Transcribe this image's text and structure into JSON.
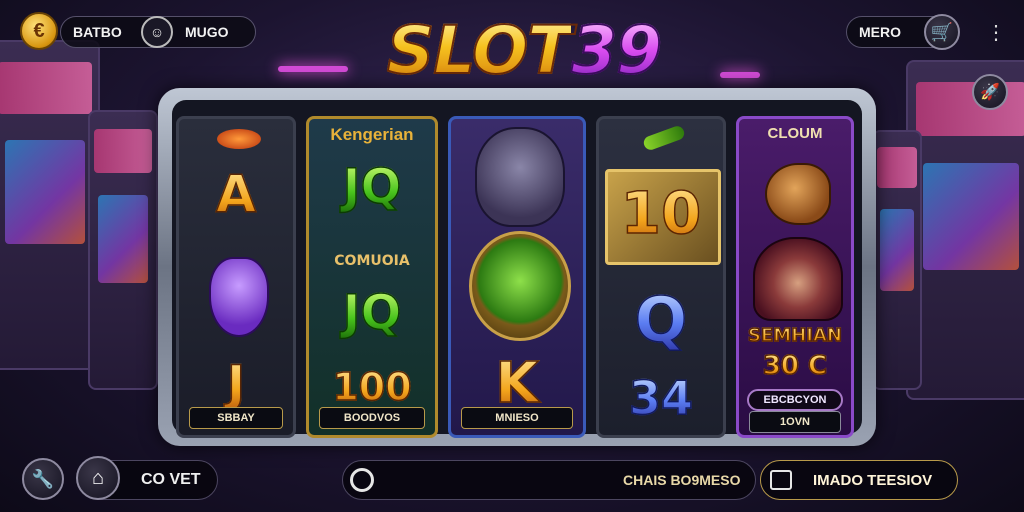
{
  "title": {
    "part1": "SLOT",
    "part2": "39"
  },
  "topbar": {
    "coin_symbol": "€",
    "left_label_1": "BATBO",
    "left_label_2": "MUGO",
    "right_label": "MERO",
    "right_icon": "shopping-cart-icon",
    "menu_icon": "more-vertical-icon",
    "corner_icon": "rocket-icon"
  },
  "reels": [
    {
      "symbols": [
        "A",
        "J"
      ],
      "footer": "SBBAY",
      "icons": [
        "bird-icon",
        "goblin-mask-icon"
      ]
    },
    {
      "header": "Kengerian",
      "middle_label": "COMUOIA",
      "symbols": [
        "JQ",
        "JQ",
        "100"
      ],
      "footer": "BOODVOS"
    },
    {
      "symbols": [
        "K"
      ],
      "footer": "MNIESO",
      "icons": [
        "demon-icon",
        "goblin-shield-icon"
      ]
    },
    {
      "symbols": [
        "10",
        "Q",
        "34"
      ],
      "icons": [
        "key-icon"
      ]
    },
    {
      "header": "CLOUM",
      "caption": "SEMHIAN",
      "value": "30 C",
      "button": "EBCBCYON",
      "footer": "1OVN",
      "icons": [
        "dragon-icon",
        "hooded-hero-icon"
      ]
    }
  ],
  "bottombar": {
    "wrench_icon": "wrench-icon",
    "home_icon": "home-icon",
    "left_label": "CO VET",
    "search_icon": "search-icon",
    "status_text": "CHAIS BO9MESO",
    "right_icon": "share-icon",
    "right_label": "IMADO TEESIOV"
  }
}
